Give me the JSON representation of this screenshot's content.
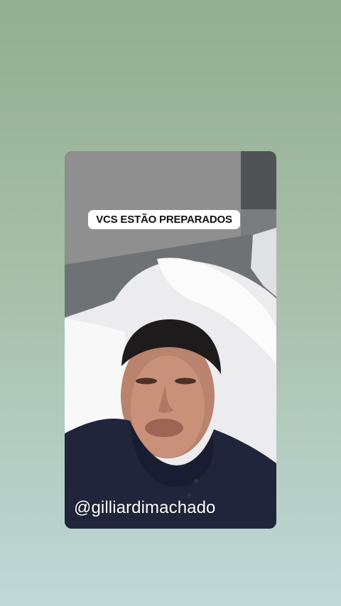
{
  "story": {
    "caption": "VCS ESTÃO PREPARADOS",
    "username": "@gilliardimachado"
  },
  "colors": {
    "background_top": "#93ae92",
    "background_bottom": "#c0d8d8",
    "caption_background": "#ffffff",
    "caption_text": "#111111",
    "username_text": "#ffffff"
  }
}
